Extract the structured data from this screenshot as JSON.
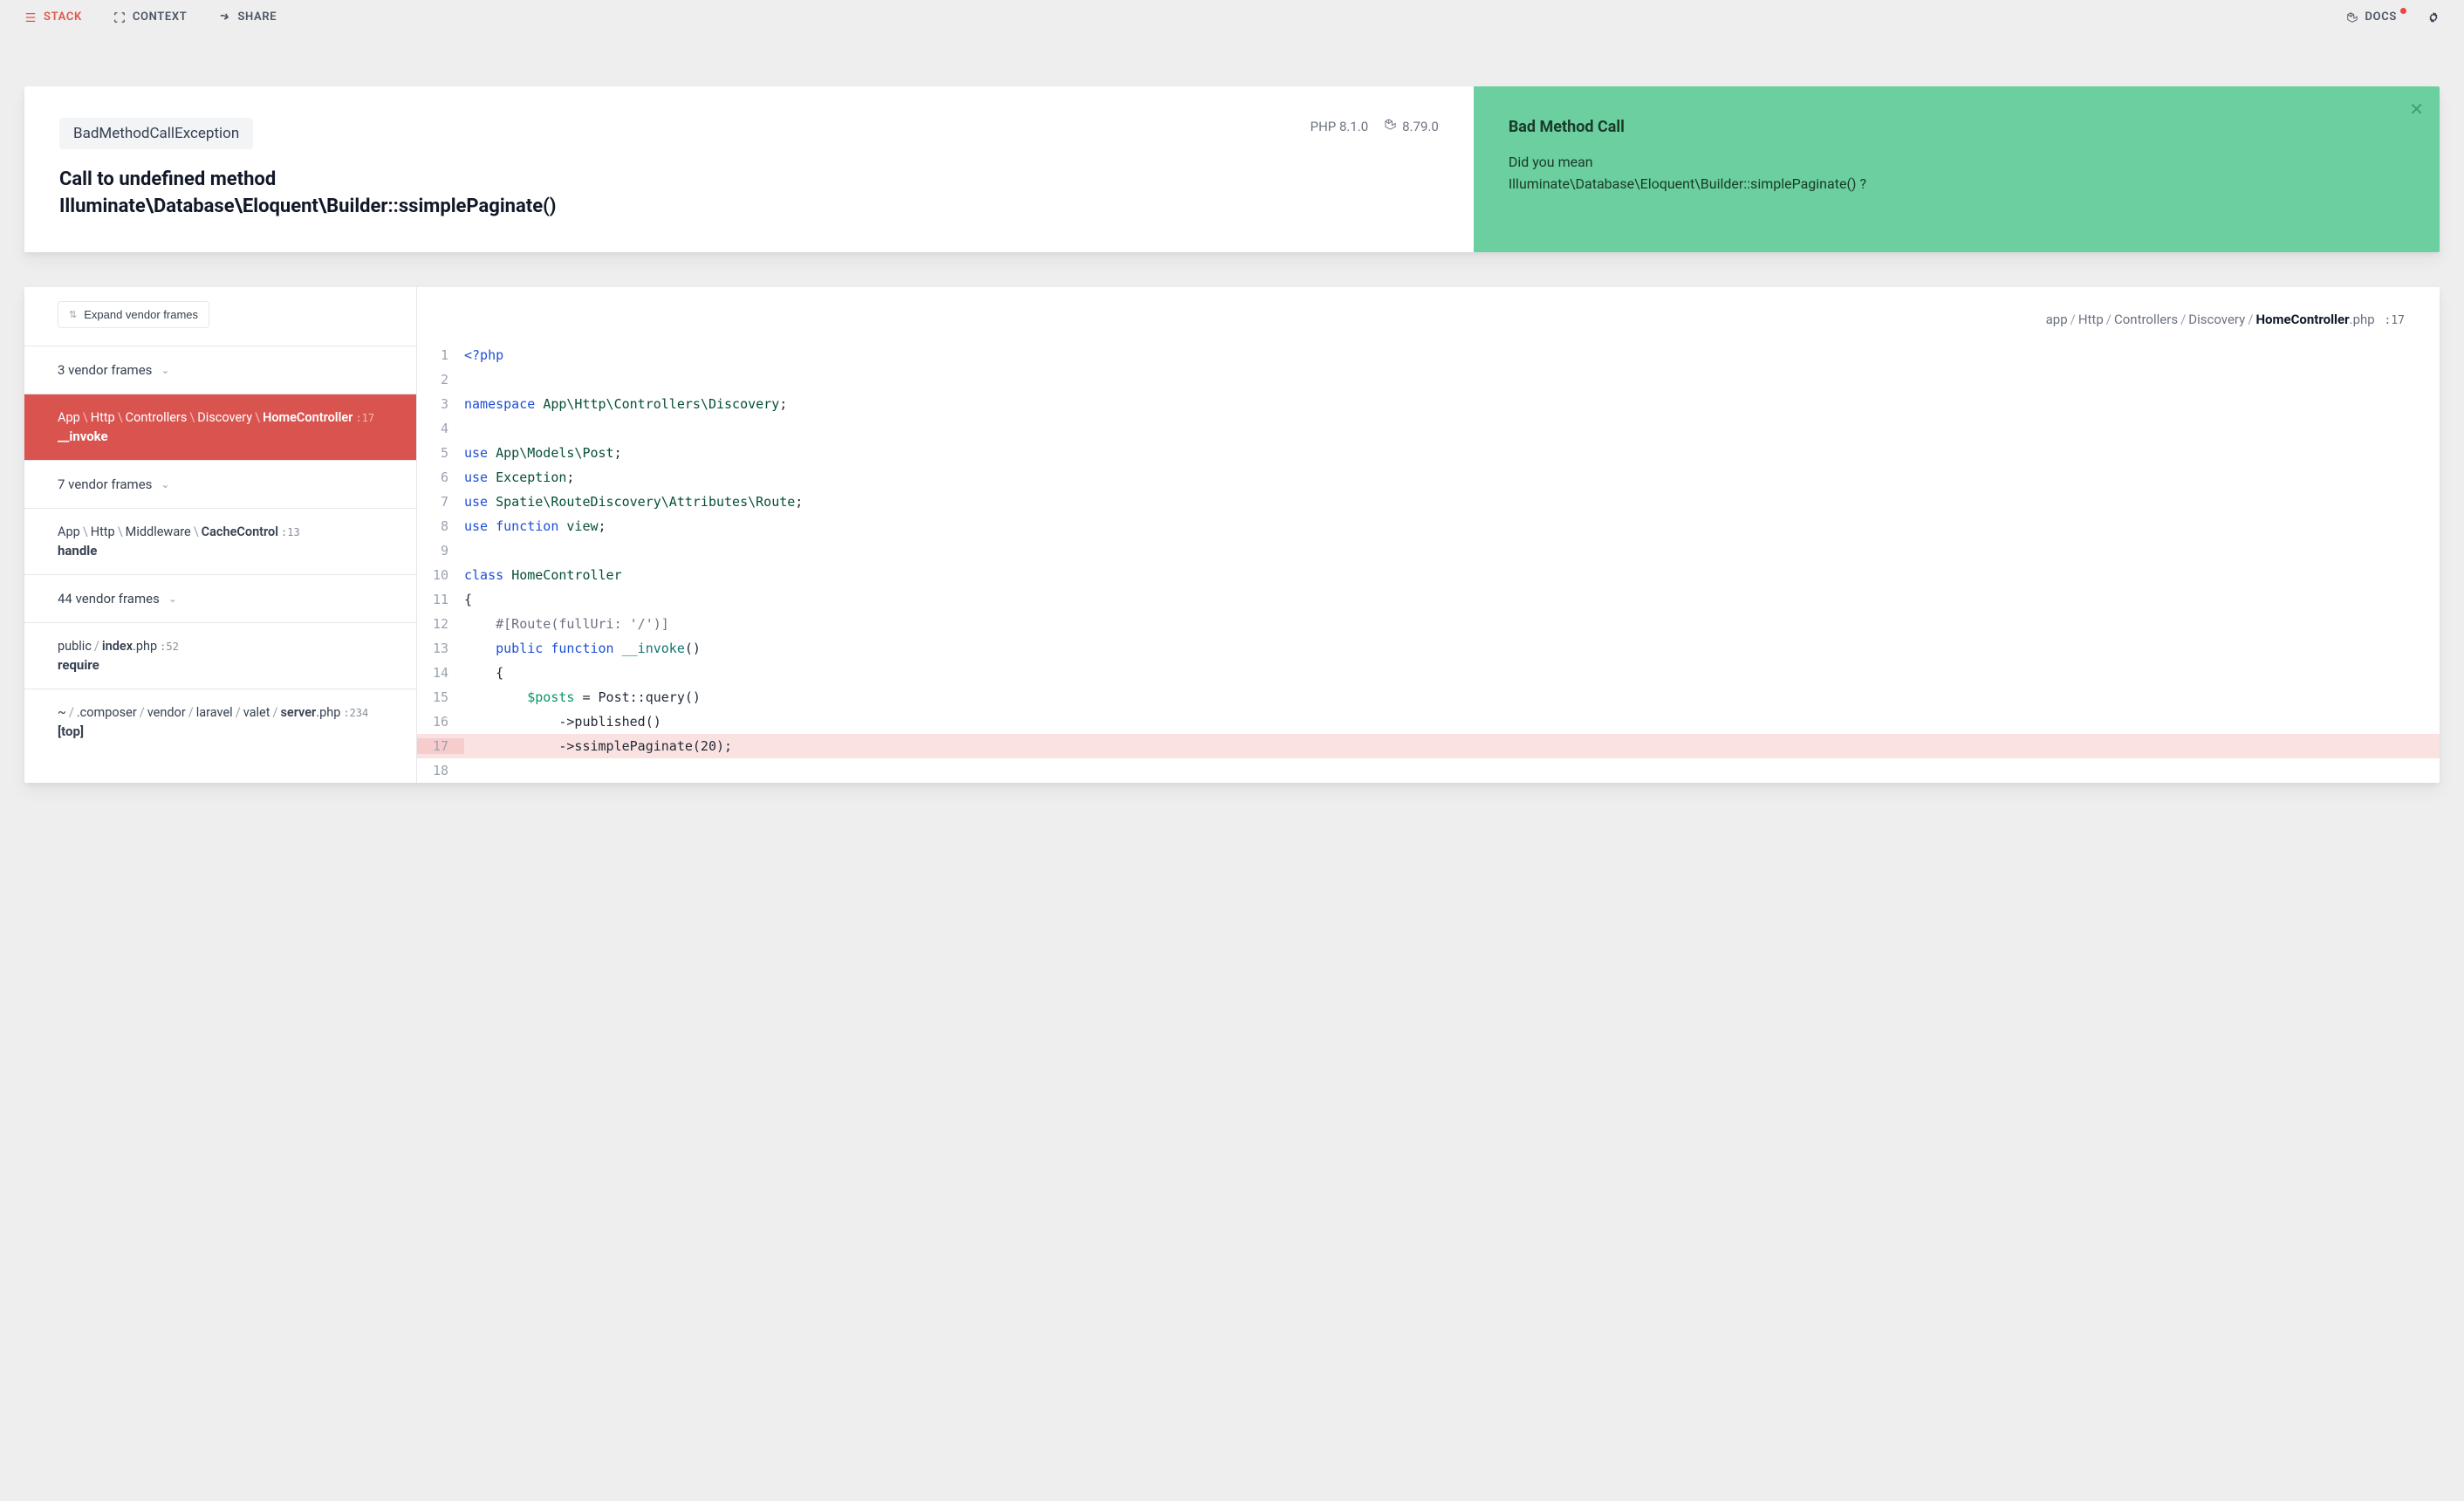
{
  "nav": {
    "stack": "STACK",
    "context": "CONTEXT",
    "share": "SHARE",
    "docs": "DOCS"
  },
  "error": {
    "exception_class": "BadMethodCallException",
    "message_line1": "Call to undefined method",
    "message_line2": "Illuminate\\Database\\Eloquent\\Builder::ssimplePaginate()",
    "php_version": "PHP 8.1.0",
    "laravel_version": "8.79.0"
  },
  "solution": {
    "title": "Bad Method Call",
    "text_line1": "Did you mean",
    "text_line2": "Illuminate\\Database\\Eloquent\\Builder::simplePaginate() ?"
  },
  "sidebar": {
    "expand_label": "Expand vendor frames",
    "frames": [
      {
        "type": "collapsed",
        "label": "3 vendor frames"
      },
      {
        "type": "frame",
        "active": true,
        "segments": [
          "App",
          "Http",
          "Controllers",
          "Discovery",
          "HomeController"
        ],
        "line": "17",
        "fn": "__invoke"
      },
      {
        "type": "collapsed",
        "label": "7 vendor frames"
      },
      {
        "type": "frame",
        "segments": [
          "App",
          "Http",
          "Middleware",
          "CacheControl"
        ],
        "line": "13",
        "fn": "handle"
      },
      {
        "type": "collapsed",
        "label": "44 vendor frames"
      },
      {
        "type": "frame",
        "path_html": "public/<b>index</b>.php",
        "segments_plain": [
          "public",
          "index.php"
        ],
        "file_bold_index": 1,
        "line": "52",
        "fn": "require"
      },
      {
        "type": "frame",
        "path_html": "~/.composer/vendor/laravel/valet/<b>server</b>.php",
        "segments_plain": [
          "~",
          ".composer",
          "vendor",
          "laravel",
          "valet",
          "server.php"
        ],
        "line": "234",
        "fn": "[top]"
      }
    ]
  },
  "file": {
    "segments": [
      "app",
      "Http",
      "Controllers",
      "Discovery"
    ],
    "filename": "HomeController",
    "ext": ".php",
    "line": "17"
  },
  "code_lines": [
    {
      "n": 1,
      "html": "<span class='tok-kw'>&lt;?php</span>"
    },
    {
      "n": 2,
      "html": ""
    },
    {
      "n": 3,
      "html": "<span class='tok-kw'>namespace</span> <span class='tok-ns'>App\\Http\\Controllers\\Discovery</span>;"
    },
    {
      "n": 4,
      "html": ""
    },
    {
      "n": 5,
      "html": "<span class='tok-kw'>use</span> <span class='tok-ns'>App\\Models\\Post</span>;"
    },
    {
      "n": 6,
      "html": "<span class='tok-kw'>use</span> <span class='tok-ns'>Exception</span>;"
    },
    {
      "n": 7,
      "html": "<span class='tok-kw'>use</span> <span class='tok-ns'>Spatie\\RouteDiscovery\\Attributes\\Route</span>;"
    },
    {
      "n": 8,
      "html": "<span class='tok-kw'>use</span> <span class='tok-kw'>function</span> <span class='tok-ns'>view</span>;"
    },
    {
      "n": 9,
      "html": ""
    },
    {
      "n": 10,
      "html": "<span class='tok-kw'>class</span> <span class='tok-ns'>HomeController</span>"
    },
    {
      "n": 11,
      "html": "{"
    },
    {
      "n": 12,
      "html": "    <span class='tok-com'>#[Route(fullUri: '/')]</span>"
    },
    {
      "n": 13,
      "html": "    <span class='tok-kw'>public</span> <span class='tok-kw'>function</span> <span class='tok-fn'>__invoke</span>()"
    },
    {
      "n": 14,
      "html": "    {"
    },
    {
      "n": 15,
      "html": "        <span class='tok-var'>$posts</span> = Post::query()"
    },
    {
      "n": 16,
      "html": "            -&gt;published()"
    },
    {
      "n": 17,
      "html": "            -&gt;ssimplePaginate(20);",
      "hl": true
    },
    {
      "n": 18,
      "html": ""
    }
  ]
}
